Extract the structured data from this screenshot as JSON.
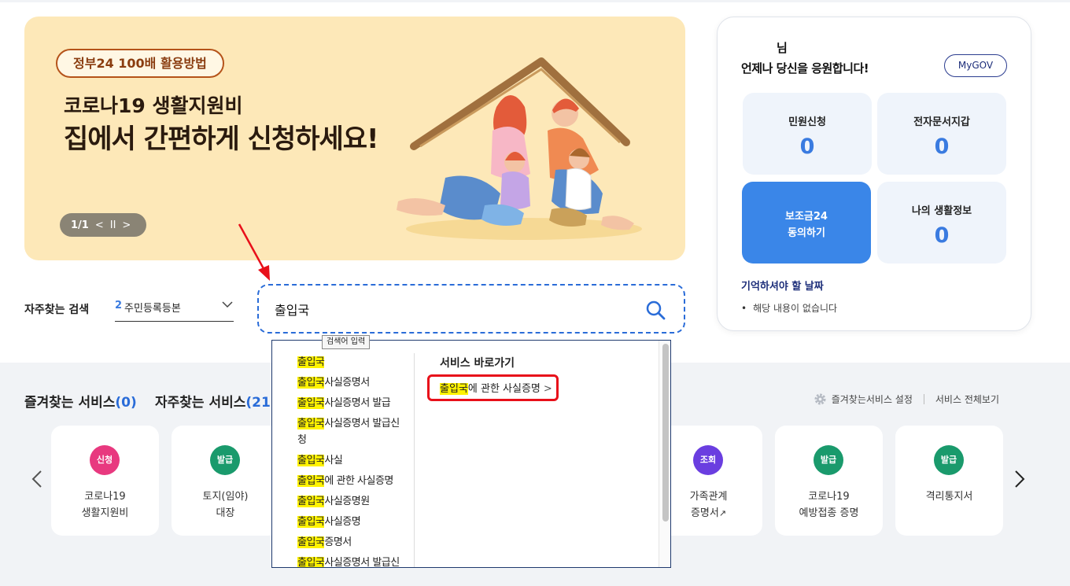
{
  "banner": {
    "badge": "정부24 100배 활용방법",
    "subtitle": "코로나19 생활지원비",
    "title": "집에서 간편하게 신청하세요!",
    "pager": {
      "current": "1/1",
      "prev": "<",
      "pause": "II",
      "next": ">"
    }
  },
  "panel": {
    "user_name": "님",
    "greeting": "언제나 당신을 응원합니다!",
    "mygov_label": "MyGOV",
    "tiles": [
      {
        "label": "민원신청",
        "count": "0"
      },
      {
        "label": "전자문서지갑",
        "count": "0"
      },
      {
        "label": "보조금24\n동의하기"
      },
      {
        "label": "나의 생활정보",
        "count": "0"
      }
    ],
    "remember_title": "기억하셔야 할 날짜",
    "remember_empty": "해당 내용이 없습니다"
  },
  "search": {
    "fav_label": "자주찾는 검색",
    "rank_num": "2",
    "rank_text": "주민등록등본",
    "value": "출입국",
    "tooltip": "검색어 입력"
  },
  "autocomplete": {
    "keyword": "출입국",
    "suggestions": [
      {
        "hl": "출입국",
        "rest": ""
      },
      {
        "hl": "출입국",
        "rest": "사실증명서"
      },
      {
        "hl": "출입국",
        "rest": "사실증명서 발급"
      },
      {
        "hl": "출입국",
        "rest": "사실증명서 발급신청"
      },
      {
        "hl": "출입국",
        "rest": "사실"
      },
      {
        "hl": "출입국",
        "rest": "에 관한 사실증명"
      },
      {
        "hl": "출입국",
        "rest": "사실증명원"
      },
      {
        "hl": "출입국",
        "rest": "사실증명"
      },
      {
        "hl": "출입국",
        "rest": "증명서"
      },
      {
        "hl": "출입국",
        "rest": "사실증명서 발급신"
      }
    ],
    "shortcut_title": "서비스 바로가기",
    "shortcut_hl": "출입국",
    "shortcut_rest": "에 관한 사실증명",
    "shortcut_arrow": ">"
  },
  "services": {
    "fav_title": "즐겨찾는 서비스",
    "fav_count": "(0)",
    "freq_title": "자주찾는 서비스",
    "freq_count": "(21)",
    "setting_label": "즐겨찾는서비스 설정",
    "all_label": "서비스 전체보기",
    "cards": [
      {
        "badge": "신청",
        "color": "#e8397f",
        "line1": "코로나19",
        "line2": "생활지원비"
      },
      {
        "badge": "발급",
        "color": "#1a9a6c",
        "line1": "토지(임야)",
        "line2": "대장"
      },
      {
        "badge": "조회",
        "color": "#6a3ee0",
        "line1": "가족관계",
        "line2": "증명서"
      },
      {
        "badge": "발급",
        "color": "#1a9a6c",
        "line1": "코로나19",
        "line2": "예방접종 증명"
      },
      {
        "badge": "발급",
        "color": "#1a9a6c",
        "line1": "격리통지서",
        "line2": ""
      }
    ],
    "external_mark": "↗"
  }
}
